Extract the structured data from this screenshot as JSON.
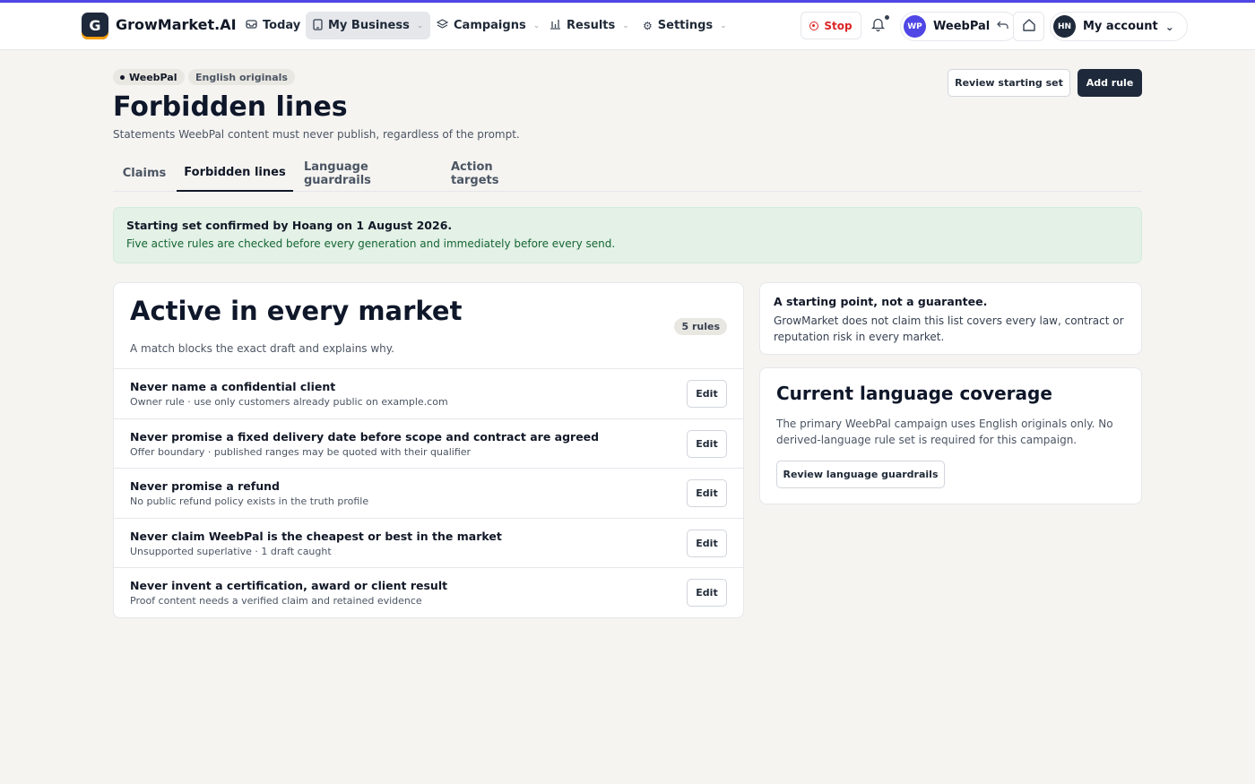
{
  "topbar": {
    "logo_letter": "G",
    "logo_text": "GrowMarket.AI",
    "nav": [
      {
        "label": "Today"
      },
      {
        "label": "My Business"
      },
      {
        "label": "Campaigns"
      },
      {
        "label": "Results"
      },
      {
        "label": "Settings"
      }
    ],
    "stop_label": "Stop",
    "workspace": {
      "initials": "WP",
      "name": "WeebPal"
    },
    "account": {
      "initials": "HN",
      "label": "My account"
    }
  },
  "header": {
    "breadcrumb": [
      "WeebPal",
      "English originals"
    ],
    "title": "Forbidden lines",
    "subtitle": "Statements WeebPal content must never publish, regardless of the prompt.",
    "review_button": "Review starting set",
    "add_button": "Add rule"
  },
  "tabs": [
    {
      "label": "Claims"
    },
    {
      "label": "Forbidden lines"
    },
    {
      "label": "Language guardrails"
    },
    {
      "label": "Action targets"
    }
  ],
  "notice": {
    "title": "Starting set confirmed by Hoang on 1 August 2026.",
    "text": "Five active rules are checked before every generation and immediately before every send."
  },
  "rules_card": {
    "title": "Active in every market",
    "count": "5 rules",
    "subtitle": "A match blocks the exact draft and explains why.",
    "edit_label": "Edit",
    "rules": [
      {
        "title": "Never name a confidential client",
        "meta": "Owner rule · use only customers already public on example.com"
      },
      {
        "title": "Never promise a fixed delivery date before scope and contract are agreed",
        "meta": "Offer boundary · published ranges may be quoted with their qualifier"
      },
      {
        "title": "Never promise a refund",
        "meta": "No public refund policy exists in the truth profile"
      },
      {
        "title": "Never claim WeebPal is the cheapest or best in the market",
        "meta": "Unsupported superlative · 1 draft caught"
      },
      {
        "title": "Never invent a certification, award or client result",
        "meta": "Proof content needs a verified claim and retained evidence"
      }
    ]
  },
  "disclaimer": {
    "title": "A starting point, not a guarantee.",
    "text": "GrowMarket does not claim this list covers every law, contract or reputation risk in every market."
  },
  "coverage": {
    "title": "Current language coverage",
    "text": "The primary WeebPal campaign uses English originals only. No derived-language rule set is required for this campaign.",
    "button": "Review language guardrails"
  },
  "colors": {
    "accent": "#4f46e5",
    "dark": "#1e293b",
    "notice_bg": "#e3f1e6",
    "notice_text": "#166534",
    "stop": "#dc2626"
  }
}
